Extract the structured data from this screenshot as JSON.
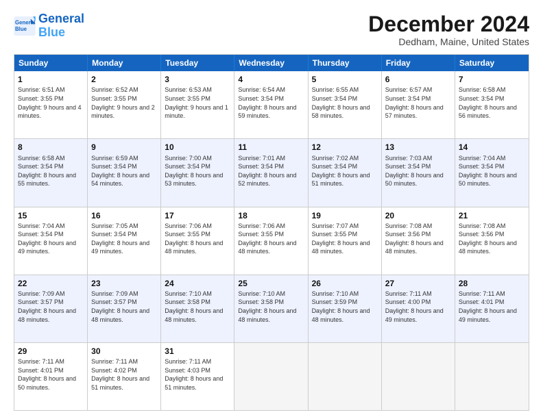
{
  "header": {
    "logo_line1": "General",
    "logo_line2": "Blue",
    "month": "December 2024",
    "location": "Dedham, Maine, United States"
  },
  "days": [
    "Sunday",
    "Monday",
    "Tuesday",
    "Wednesday",
    "Thursday",
    "Friday",
    "Saturday"
  ],
  "rows": [
    [
      {
        "day": "1",
        "rise": "6:51 AM",
        "set": "3:55 PM",
        "daylight": "9 hours and 4 minutes."
      },
      {
        "day": "2",
        "rise": "6:52 AM",
        "set": "3:55 PM",
        "daylight": "9 hours and 2 minutes."
      },
      {
        "day": "3",
        "rise": "6:53 AM",
        "set": "3:55 PM",
        "daylight": "9 hours and 1 minute."
      },
      {
        "day": "4",
        "rise": "6:54 AM",
        "set": "3:54 PM",
        "daylight": "8 hours and 59 minutes."
      },
      {
        "day": "5",
        "rise": "6:55 AM",
        "set": "3:54 PM",
        "daylight": "8 hours and 58 minutes."
      },
      {
        "day": "6",
        "rise": "6:57 AM",
        "set": "3:54 PM",
        "daylight": "8 hours and 57 minutes."
      },
      {
        "day": "7",
        "rise": "6:58 AM",
        "set": "3:54 PM",
        "daylight": "8 hours and 56 minutes."
      }
    ],
    [
      {
        "day": "8",
        "rise": "6:58 AM",
        "set": "3:54 PM",
        "daylight": "8 hours and 55 minutes."
      },
      {
        "day": "9",
        "rise": "6:59 AM",
        "set": "3:54 PM",
        "daylight": "8 hours and 54 minutes."
      },
      {
        "day": "10",
        "rise": "7:00 AM",
        "set": "3:54 PM",
        "daylight": "8 hours and 53 minutes."
      },
      {
        "day": "11",
        "rise": "7:01 AM",
        "set": "3:54 PM",
        "daylight": "8 hours and 52 minutes."
      },
      {
        "day": "12",
        "rise": "7:02 AM",
        "set": "3:54 PM",
        "daylight": "8 hours and 51 minutes."
      },
      {
        "day": "13",
        "rise": "7:03 AM",
        "set": "3:54 PM",
        "daylight": "8 hours and 50 minutes."
      },
      {
        "day": "14",
        "rise": "7:04 AM",
        "set": "3:54 PM",
        "daylight": "8 hours and 50 minutes."
      }
    ],
    [
      {
        "day": "15",
        "rise": "7:04 AM",
        "set": "3:54 PM",
        "daylight": "8 hours and 49 minutes."
      },
      {
        "day": "16",
        "rise": "7:05 AM",
        "set": "3:54 PM",
        "daylight": "8 hours and 49 minutes."
      },
      {
        "day": "17",
        "rise": "7:06 AM",
        "set": "3:55 PM",
        "daylight": "8 hours and 48 minutes."
      },
      {
        "day": "18",
        "rise": "7:06 AM",
        "set": "3:55 PM",
        "daylight": "8 hours and 48 minutes."
      },
      {
        "day": "19",
        "rise": "7:07 AM",
        "set": "3:55 PM",
        "daylight": "8 hours and 48 minutes."
      },
      {
        "day": "20",
        "rise": "7:08 AM",
        "set": "3:56 PM",
        "daylight": "8 hours and 48 minutes."
      },
      {
        "day": "21",
        "rise": "7:08 AM",
        "set": "3:56 PM",
        "daylight": "8 hours and 48 minutes."
      }
    ],
    [
      {
        "day": "22",
        "rise": "7:09 AM",
        "set": "3:57 PM",
        "daylight": "8 hours and 48 minutes."
      },
      {
        "day": "23",
        "rise": "7:09 AM",
        "set": "3:57 PM",
        "daylight": "8 hours and 48 minutes."
      },
      {
        "day": "24",
        "rise": "7:10 AM",
        "set": "3:58 PM",
        "daylight": "8 hours and 48 minutes."
      },
      {
        "day": "25",
        "rise": "7:10 AM",
        "set": "3:58 PM",
        "daylight": "8 hours and 48 minutes."
      },
      {
        "day": "26",
        "rise": "7:10 AM",
        "set": "3:59 PM",
        "daylight": "8 hours and 48 minutes."
      },
      {
        "day": "27",
        "rise": "7:11 AM",
        "set": "4:00 PM",
        "daylight": "8 hours and 49 minutes."
      },
      {
        "day": "28",
        "rise": "7:11 AM",
        "set": "4:01 PM",
        "daylight": "8 hours and 49 minutes."
      }
    ],
    [
      {
        "day": "29",
        "rise": "7:11 AM",
        "set": "4:01 PM",
        "daylight": "8 hours and 50 minutes."
      },
      {
        "day": "30",
        "rise": "7:11 AM",
        "set": "4:02 PM",
        "daylight": "8 hours and 51 minutes."
      },
      {
        "day": "31",
        "rise": "7:11 AM",
        "set": "4:03 PM",
        "daylight": "8 hours and 51 minutes."
      },
      null,
      null,
      null,
      null
    ]
  ]
}
